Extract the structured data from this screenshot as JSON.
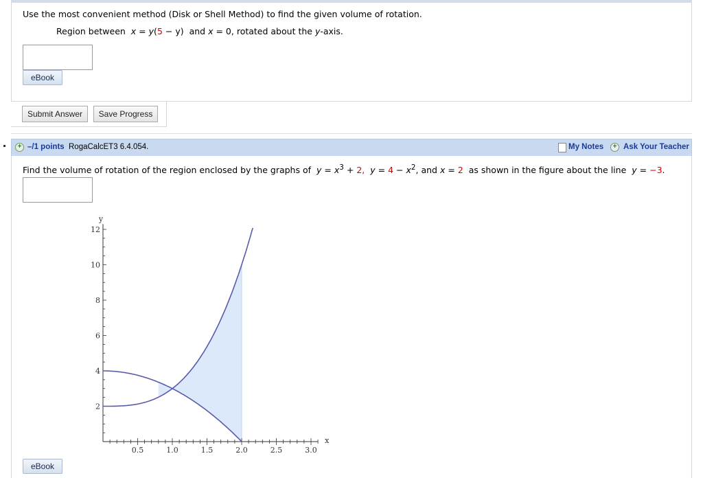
{
  "q1": {
    "instruction": "Use the most convenient method (Disk or Shell Method) to find the given volume of rotation.",
    "region_prefix": "Region between",
    "x_var": "x",
    "eq": "=",
    "y_var": "y",
    "open_paren": "(",
    "five": "5",
    "minus_y": "− y)",
    "and": "and",
    "x2": "x",
    "eq2": "= 0,",
    "rotated": "rotated about the",
    "yaxis": "y",
    "axis_suffix": "-axis.",
    "ebook_label": "eBook"
  },
  "actions": {
    "submit_label": "Submit Answer",
    "save_label": "Save Progress"
  },
  "q2": {
    "points": "–/1 points",
    "code": "RogaCalcET3 6.4.054.",
    "my_notes": "My Notes",
    "ask_teacher": "Ask Your Teacher",
    "prompt_start": "Find the volume of rotation of the region enclosed by the graphs of",
    "f1_y": "y",
    "f1_eq": "=",
    "f1_x": "x",
    "f1_exp": "3",
    "f1_plus": "+",
    "f1_const": "2,",
    "f2_y": "y",
    "f2_eq": "=",
    "f2_const": "4",
    "f2_minus": "−",
    "f2_x": "x",
    "f2_exp": "2",
    "f2_and": ", and",
    "f3_x": "x",
    "f3_eq": "=",
    "f3_val": "2",
    "prompt_mid": "as shown in the figure about the line",
    "f4_y": "y",
    "f4_eq": "=",
    "f4_val": "−3",
    "f4_end": ".",
    "ebook_label": "eBook"
  },
  "chart_data": {
    "type": "line",
    "xlabel": "x",
    "ylabel": "y",
    "xlim": [
      0,
      3.1
    ],
    "ylim": [
      0,
      12
    ],
    "x_ticks": [
      "0.5",
      "1.0",
      "1.5",
      "2.0",
      "2.5",
      "3.0"
    ],
    "y_ticks": [
      "2",
      "4",
      "6",
      "8",
      "10",
      "12"
    ],
    "series": [
      {
        "function": "x^3 + 2",
        "color": "#5a5aaa"
      },
      {
        "function": "4 - x^2",
        "color": "#5a5aaa"
      }
    ],
    "shaded_region": {
      "x_from": 0.8,
      "x_to": 2.0,
      "color": "#dce9fb"
    },
    "line_color": "#5a5aaa",
    "shade_color": "#dce9fb"
  }
}
